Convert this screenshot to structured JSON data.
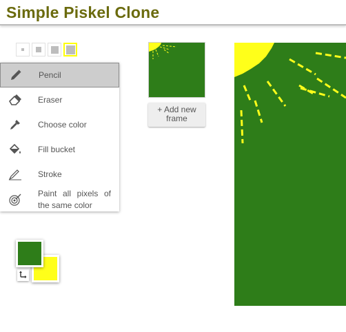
{
  "app": {
    "title": "Simple Piskel Clone"
  },
  "pen_sizes": [
    {
      "icon": "pen-size-1-icon",
      "selected": false
    },
    {
      "icon": "pen-size-2-icon",
      "selected": false
    },
    {
      "icon": "pen-size-3-icon",
      "selected": false
    },
    {
      "icon": "pen-size-4-icon",
      "selected": true
    }
  ],
  "tools": [
    {
      "label": "Pencil",
      "icon": "pencil-icon",
      "selected": true
    },
    {
      "label": "Eraser",
      "icon": "eraser-icon",
      "selected": false
    },
    {
      "label": "Choose color",
      "icon": "eyedropper-icon",
      "selected": false
    },
    {
      "label": "Fill bucket",
      "icon": "fill-bucket-icon",
      "selected": false
    },
    {
      "label": "Stroke",
      "icon": "stroke-icon",
      "selected": false
    },
    {
      "label": "Paint all pixels of the same color",
      "icon": "paint-same-color-icon",
      "selected": false
    }
  ],
  "colors": {
    "primary": "#2e7d19",
    "secondary": "#ffff1a",
    "swap_icon": "swap-colors-icon"
  },
  "frames": {
    "add_label": "+ Add new frame"
  },
  "canvas": {
    "background": "#2e7d19",
    "sun_color": "#ffff1a"
  }
}
